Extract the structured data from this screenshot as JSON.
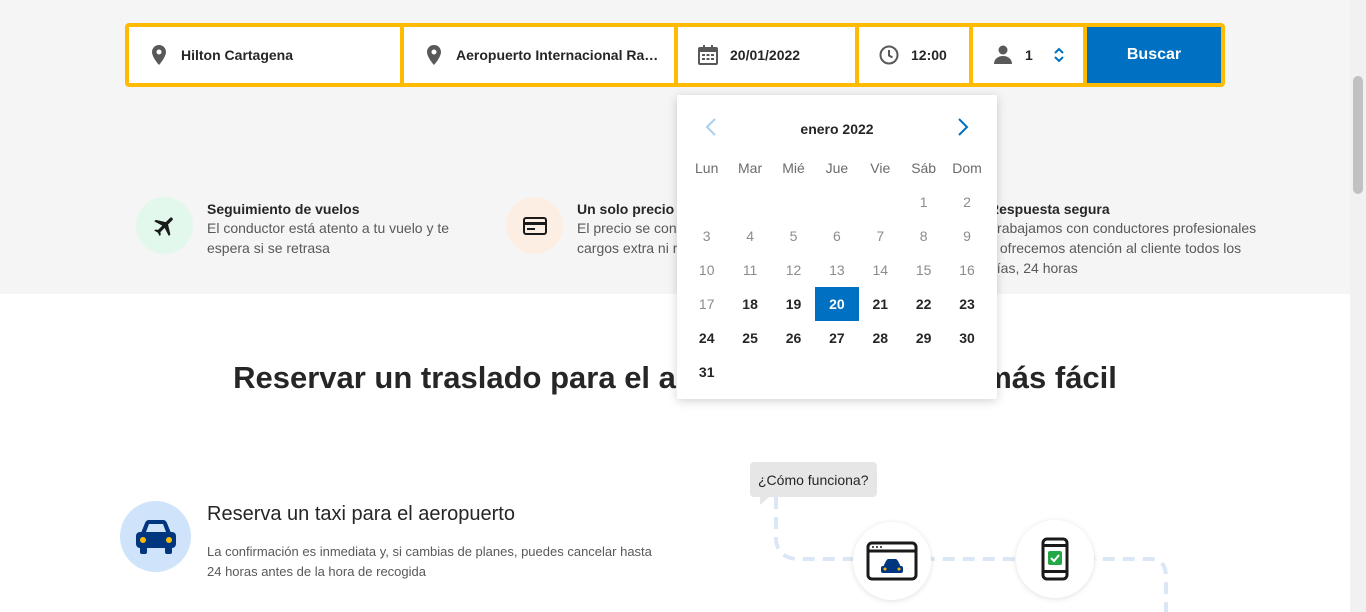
{
  "search": {
    "pickup": "Hilton Cartagena",
    "dropoff": "Aeropuerto Internacional Rafael Núñez",
    "date": "20/01/2022",
    "time": "12:00",
    "passengers": "1",
    "button": "Buscar"
  },
  "features": [
    {
      "title": "Seguimiento de vuelos",
      "desc": "El conductor está atento a tu vuelo y te espera si se retrasa",
      "icon": "plane-icon"
    },
    {
      "title": "Un solo precio",
      "desc": "El precio se confirma al reservar, sin cargos extra ni recargos",
      "icon": "credit-card-icon"
    },
    {
      "title": "Respuesta segura",
      "desc": "Trabajamos con conductores profesionales y ofrecemos atención al cliente todos los días, 24 horas",
      "icon": "shield-icon"
    }
  ],
  "main_heading": "Reservar un traslado para el aeropuerto nunca fue más fácil",
  "taxi": {
    "title": "Reserva un taxi para el aeropuerto",
    "desc": "La confirmación es inmediata y, si cambias de planes, puedes cancelar hasta 24 horas antes de la hora de recogida"
  },
  "how_it_works": "¿Cómo funciona?",
  "calendar": {
    "month": "enero 2022",
    "weekdays": [
      "Lun",
      "Mar",
      "Mié",
      "Jue",
      "Vie",
      "Sáb",
      "Dom"
    ],
    "leading_blanks": 5,
    "days_in_month": 31,
    "last_past_day": 17,
    "selected_day": 20
  },
  "colors": {
    "accent_yellow": "#febb02",
    "primary_blue": "#0071c2",
    "hero_bg": "#f5f5f5"
  }
}
